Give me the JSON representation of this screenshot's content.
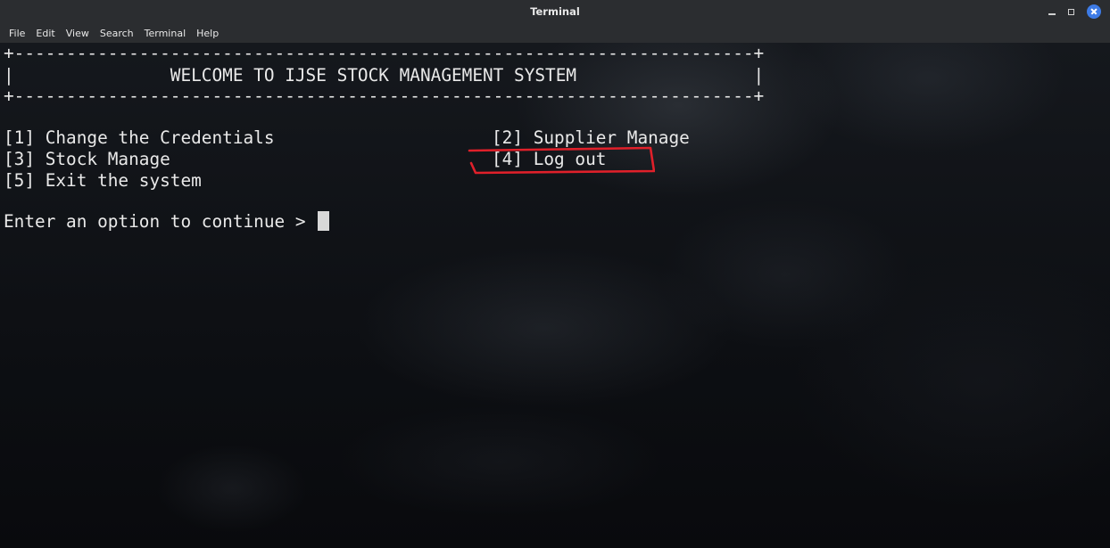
{
  "window": {
    "title": "Terminal"
  },
  "menu": {
    "items": [
      "File",
      "Edit",
      "View",
      "Search",
      "Terminal",
      "Help"
    ]
  },
  "terminal": {
    "border_top": "+-----------------------------------------------------------------------+",
    "header_line": "|               WELCOME TO IJSE STOCK MANAGEMENT SYSTEM                 |",
    "border_bottom": "+-----------------------------------------------------------------------+",
    "options": [
      "[1] Change the Credentials",
      "[2] Supplier Manage",
      "[3] Stock Manage",
      "[4] Log out",
      "[5] Exit the system"
    ],
    "prompt": "Enter an option to continue > "
  },
  "annotation": {
    "color": "#e0202a"
  },
  "colors": {
    "titlebar": "#2b2d30",
    "close_button": "#3d7be6",
    "terminal_text": "#e9e9e9"
  }
}
